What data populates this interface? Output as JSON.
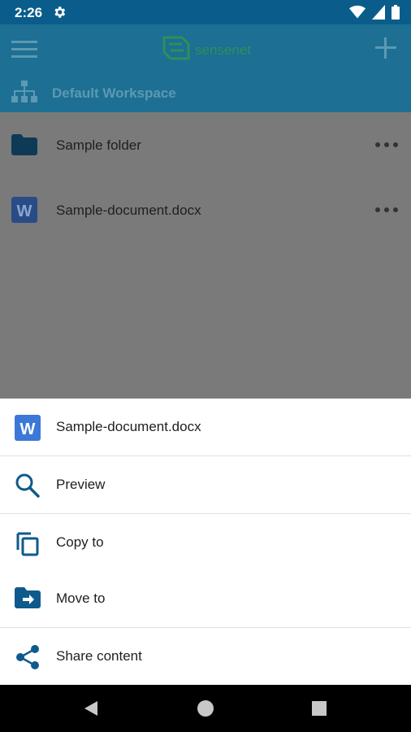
{
  "status_bar": {
    "time": "2:26",
    "icons": [
      "settings-icon",
      "wifi-icon",
      "signal-icon",
      "battery-icon"
    ]
  },
  "app_bar": {
    "logo_text": "sensenet",
    "menu_icon": "menu-icon",
    "add_icon": "add-icon"
  },
  "breadcrumb": {
    "icon": "sitemap-icon",
    "label": "Default Workspace"
  },
  "list": {
    "items": [
      {
        "label": "Sample folder",
        "icon": "folder-icon"
      },
      {
        "label": "Sample-document.docx",
        "icon": "word-document-icon"
      }
    ]
  },
  "sheet": {
    "header": {
      "label": "Sample-document.docx",
      "icon": "word-document-icon"
    },
    "actions": [
      {
        "label": "Preview",
        "icon": "search-icon"
      },
      {
        "label": "Copy to",
        "icon": "copy-icon"
      },
      {
        "label": "Move to",
        "icon": "move-folder-icon"
      },
      {
        "label": "Share content",
        "icon": "share-icon"
      }
    ]
  },
  "colors": {
    "status_bar": "#0a5d8a",
    "app_bar": "#1d6f93",
    "accent_blue": "#0f5a8c",
    "word_blue": "#3b78d8",
    "scrim": "#7a7a7a"
  }
}
